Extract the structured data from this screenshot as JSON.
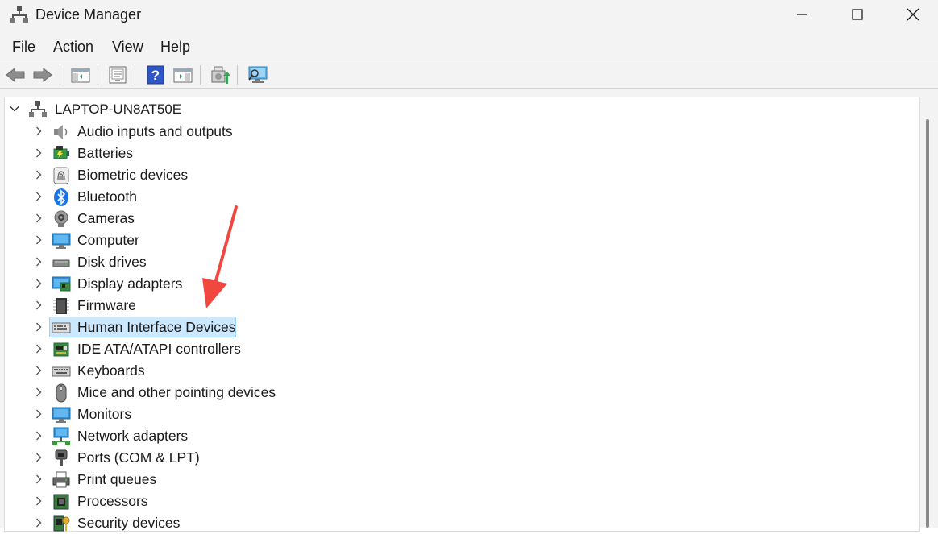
{
  "window": {
    "title": "Device Manager"
  },
  "menubar": {
    "items": [
      "File",
      "Action",
      "View",
      "Help"
    ]
  },
  "toolbar": {
    "buttons": [
      "back-icon",
      "forward-icon",
      "show-hide-console-tree-icon",
      "properties-icon",
      "help-icon",
      "action-pane-icon",
      "update-driver-icon",
      "scan-hardware-icon"
    ]
  },
  "tree": {
    "root": "LAPTOP-UN8AT50E",
    "items": [
      {
        "label": "Audio inputs and outputs",
        "icon": "speaker-icon"
      },
      {
        "label": "Batteries",
        "icon": "battery-icon"
      },
      {
        "label": "Biometric devices",
        "icon": "fingerprint-icon"
      },
      {
        "label": "Bluetooth",
        "icon": "bluetooth-icon"
      },
      {
        "label": "Cameras",
        "icon": "camera-icon"
      },
      {
        "label": "Computer",
        "icon": "computer-icon"
      },
      {
        "label": "Disk drives",
        "icon": "disk-drive-icon"
      },
      {
        "label": "Display adapters",
        "icon": "display-adapter-icon"
      },
      {
        "label": "Firmware",
        "icon": "firmware-chip-icon"
      },
      {
        "label": "Human Interface Devices",
        "icon": "hid-icon",
        "selected": true
      },
      {
        "label": "IDE ATA/ATAPI controllers",
        "icon": "ide-controller-icon"
      },
      {
        "label": "Keyboards",
        "icon": "keyboard-icon"
      },
      {
        "label": "Mice and other pointing devices",
        "icon": "mouse-icon"
      },
      {
        "label": "Monitors",
        "icon": "monitor-icon"
      },
      {
        "label": "Network adapters",
        "icon": "network-adapter-icon"
      },
      {
        "label": "Ports (COM & LPT)",
        "icon": "port-icon"
      },
      {
        "label": "Print queues",
        "icon": "printer-icon"
      },
      {
        "label": "Processors",
        "icon": "processor-icon"
      },
      {
        "label": "Security devices",
        "icon": "security-device-icon"
      }
    ]
  },
  "colors": {
    "chrome": "#f3f3f3",
    "selection": "#cce8ff",
    "selection_border": "#99d1ff",
    "annotation_arrow": "#f0483e"
  }
}
